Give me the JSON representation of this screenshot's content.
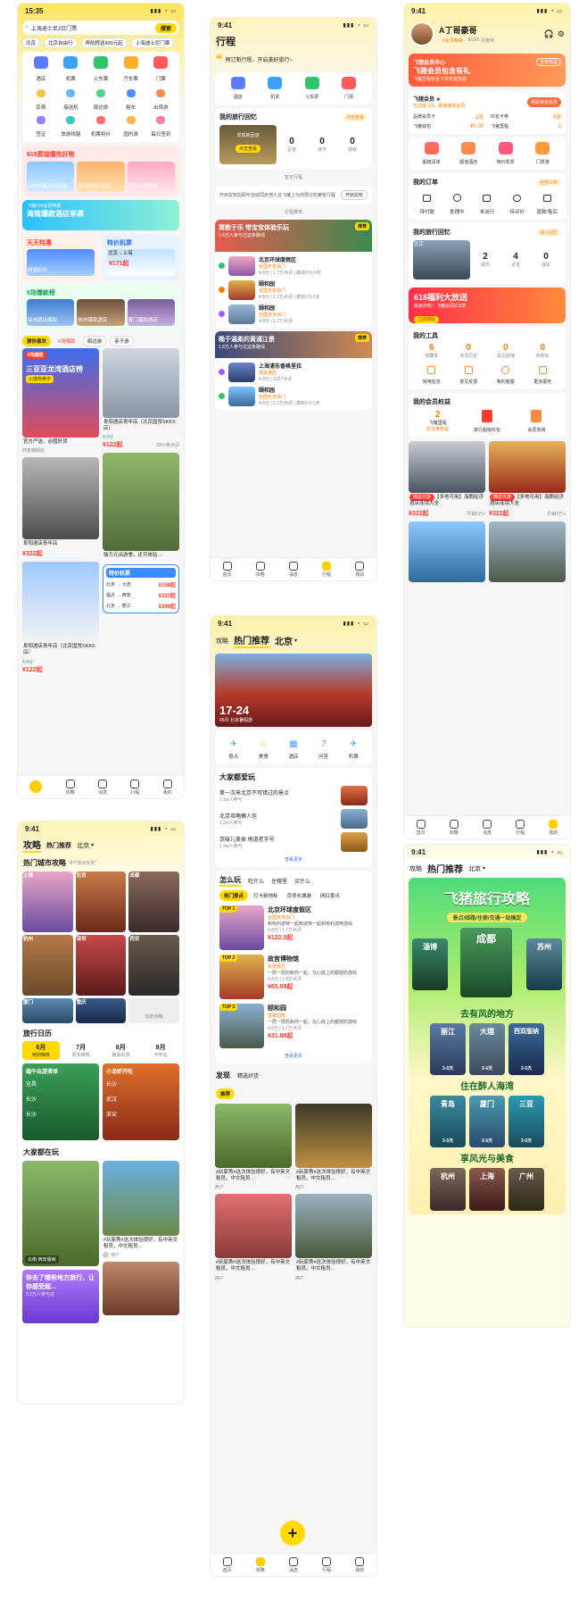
{
  "status_time_a": "15:35",
  "status_time": "9:41",
  "a": {
    "search_placeholder": "上海迪士尼2日门票",
    "search_btn": "搜索",
    "quick": [
      "北京",
      "北京自由行",
      "再航程送499元起",
      "上海迪士尼门票"
    ],
    "main_icons": [
      "酒店",
      "机票",
      "火车票",
      "汽车票",
      "门票"
    ],
    "sub_icons": [
      "民宿",
      "接送机",
      "周边游",
      "租车",
      "出境游",
      "签证",
      "旅游线路",
      "机票特价",
      "国内游",
      "每日签到"
    ],
    "promo1_title": "618费瑞播抢好物",
    "promo1_items": [
      "大会员每日抢全部",
      "每日好价0元起",
      "迪士尼城堡游"
    ],
    "promo2_title": "海南爆款酒店来袭",
    "promo2_sub": "飞猪618会员特惠",
    "deal_title": "天天特惠",
    "deal_sub": "超值好价",
    "flight_title": "特价机票",
    "flight_city": "北京→上海",
    "flight_price": "¥171起",
    "hotel_title": "6场爆款榜",
    "hotel_items": [
      "亚洲酒店爆款",
      "杭州爆款酒店",
      "厦门爆款酒店"
    ],
    "chips": [
      "猜你喜欢",
      "6场爆款",
      "周边游",
      "亲子游"
    ],
    "feed1_badge": "6场爆款",
    "feed1_title": "三亚亚龙湾酒店榜",
    "feed1_tag": "火爆热卖中",
    "feed1_cap": "官方严选，必囤好货",
    "feed1_shop": "商家旗舰店",
    "feed2_cap": "阜阳酒店青年店（北京国贸SKKS店）",
    "feed2_score": "4.9分",
    "feed2_price": "¥122起",
    "feed2_sold": "100+条点评",
    "feed3_cap": "阜阳酒店青年店",
    "feed3_price": "¥322起",
    "feed4_cap": "独万元出游季，还可体验…",
    "feed5_cap": "阜阳酒店青年店（北京国贸SKKS店）",
    "feed5_score": "4.9分",
    "feed5_price": "¥122起",
    "flight_card_title": "特价机票",
    "flight_rows": [
      {
        "route": "北京 → 大连",
        "price": "¥158起"
      },
      {
        "route": "临沂 → 西安",
        "price": "¥323起"
      },
      {
        "route": "北京 → 丽江",
        "price": "¥399起"
      }
    ],
    "tabs": [
      "",
      "攻略",
      "消息",
      "行程",
      "我的"
    ]
  },
  "b": {
    "title": "行程",
    "greeting": "预订新行程，开启美好旅行~",
    "icons": [
      "酒店",
      "机票",
      "火车票",
      "门票"
    ],
    "memory_title": "我的旅行回忆",
    "memory_link": "点击查看",
    "memory_card": "发现新足迹",
    "memory_btn": "点击查看",
    "stats": [
      {
        "v": "0",
        "l": "足迹"
      },
      {
        "v": "0",
        "l": "城市"
      },
      {
        "v": "0",
        "l": "成就"
      }
    ],
    "empty": "暂无行程",
    "auth_text": "开启授权后即可自动同步他人在飞猪上为你预订的某些行程",
    "auth_btn": "开启授权",
    "rec": "行程推荐",
    "rec1_title": "寓教于乐 带宝宝体验乐玩",
    "rec1_sub": "1.6万人参与过这条路线",
    "rec_badge": "推荐",
    "rec_items": [
      {
        "t": "北京环球度假区",
        "tag": "全国天天出门",
        "s": "4.8分 | 1.7万点评 | 路线约3小时"
      },
      {
        "t": "颐和园",
        "tag": "全国天天出门",
        "s": "4.8分 | 1.7万点评 | 游玩0.5-1天"
      },
      {
        "t": "颐和园",
        "tag": "全国天天出门",
        "s": "4.8分 | 1.7万点评"
      }
    ],
    "rec2_title": "晚于温柔的黄浦江景",
    "rec2_sub": "1.8万人参与过这条路线",
    "rec2_items": [
      {
        "t": "上海浦东香格里拉",
        "tag": "高级酒店",
        "s": "4.8分 | 1327点评"
      },
      {
        "t": "颐和园",
        "tag": "全国天天出门",
        "s": "4.8分 | 1.7万点评 | 游玩0.5-1天"
      }
    ],
    "tabs": [
      "首页",
      "攻略",
      "消息",
      "行程",
      "我的"
    ]
  },
  "c": {
    "name": "A丁哥豪哥",
    "tags": [
      "#会员等级",
      "8/165",
      "月度奖"
    ],
    "vip_title": "飞猪会员中心",
    "vip_text": "飞猪会员包含有礼",
    "vip_sub": "飞猪里程包含下单享受权益",
    "vip_btn": "全部权益",
    "level": "飞猪会员 ★",
    "level_sub": "已达成 1/2，距离高级会员",
    "level_btn": "领取黄金会员",
    "perks": [
      {
        "l": "品牌会员卡",
        "v": "1张"
      },
      {
        "l": "红包卡券",
        "v": "0张"
      },
      {
        "l": "飞猪钱包",
        "v": "¥0.00"
      },
      {
        "l": "飞猪里程",
        "v": "2"
      }
    ],
    "icons": [
      "超值清单",
      "超值酒店",
      "特价机票",
      "门票游"
    ],
    "orders_title": "我的订单",
    "orders_link": "全部订单",
    "orders": [
      "待付款",
      "处理中",
      "未出行",
      "待评价",
      "退款/售后"
    ],
    "memory_title": "我的旅行回忆",
    "memory_link": "进入回忆",
    "memory_city": "北京",
    "memory_stats": [
      {
        "v": "2",
        "l": "城市"
      },
      {
        "v": "4",
        "l": "足迹"
      },
      {
        "v": "0",
        "l": "成就"
      }
    ],
    "sale_title": "618福利大放送",
    "sale_sub": "就差你啦！飞猪会员618享",
    "sale_btn": "立即领取",
    "tools_title": "我的工具",
    "tools_stats": [
      {
        "v": "6",
        "l": "收藏夹"
      },
      {
        "v": "0",
        "l": "浏览历史"
      },
      {
        "v": "0",
        "l": "关注店铺"
      },
      {
        "v": "0",
        "l": "购物车"
      }
    ],
    "tools": [
      "常用信息",
      "意见反馈",
      "我的客服",
      "更多服务"
    ],
    "rights_title": "我的会员权益",
    "rights": [
      {
        "v": "2",
        "l": "飞猪里程"
      },
      {
        "v": "",
        "l": "旅行超级红包"
      },
      {
        "v": "",
        "l": "会员商城"
      }
    ],
    "rights_sub": "去兑换权益",
    "goods": [
      {
        "tag": "精选日游",
        "t": "【多地可用】海朗经济酒店连锁大全",
        "p": "¥322起",
        "s": "月销5万+"
      },
      {
        "tag": "精选日游",
        "t": "【多地可用】海朗经济酒店连锁大全",
        "p": "¥322起",
        "s": "月销5万+"
      }
    ],
    "tabs": [
      "首页",
      "攻略",
      "消息",
      "行程",
      "我的"
    ]
  },
  "d": {
    "tabs_top": [
      "攻略",
      "热门推荐",
      "北京"
    ],
    "hot_title": "热门城市攻略",
    "hot_sub": "“8个热点任务”",
    "cities": [
      "上海",
      "北京",
      "成都",
      "杭州",
      "深圳",
      "西安",
      "厦门",
      "重庆",
      "西安"
    ],
    "more": "玩的攻略",
    "cal_title": "旅行日历",
    "cal": [
      {
        "m": "6月",
        "s": "特别推荐"
      },
      {
        "m": "7月",
        "s": "更多推荐"
      },
      {
        "m": "8月",
        "s": "暑假出游"
      },
      {
        "m": "9月",
        "s": "开学后"
      }
    ],
    "list1_title": "端午出游清单",
    "list1": [
      "宜昌",
      "长沙",
      "长沙"
    ],
    "list2_title": "小龙虾开吃",
    "list2": [
      "长沙",
      "武汉",
      "淮安"
    ],
    "play_title": "大家都在玩",
    "play1_tag": "云南·西双版纳",
    "play2_cap": "#玩家秀#这次体验很好，有中英文租员，中文租员…",
    "play2_user": "用户",
    "play3_cap": "你去了哪些地方旅行，让你感受超…",
    "play3_sub": "2.2万人参与过"
  },
  "e": {
    "tabs_top": [
      "攻略",
      "热门推荐",
      "北京"
    ],
    "hero_date": "17-24",
    "hero_sub": "06月 北京暑假游",
    "icons": [
      "景点",
      "美食",
      "酒店",
      "问答",
      "机票"
    ],
    "love_title": "大家都爱玩",
    "love": [
      {
        "t": "第一次来北京不可错过的景点",
        "s": "2.1w人参与"
      },
      {
        "t": "北京攻略懒人包",
        "s": "1.2w人参与"
      },
      {
        "t": "京味儿美食 地道老字号",
        "s": "1.4w人参与"
      }
    ],
    "love_more": "查看更多",
    "how_tabs": [
      "怎么玩",
      "吃什么",
      "住哪里",
      "买什么"
    ],
    "how_chips": [
      "热门景点",
      "打卡新地标",
      "京郊长城游",
      "网红景点"
    ],
    "spots": [
      {
        "rank": "TOP 1",
        "t": "北京环球度假区",
        "tag": "全国天天出门",
        "d": "和哈利波特一起和波特一起和哈利波特游戏",
        "s": "4.8分 | 1.7万点评",
        "p": "¥122.0起"
      },
      {
        "rank": "TOP 2",
        "t": "故宫博物馆",
        "tag": "免费景区",
        "d": "一层一层的和你一起，在心底上的都部的游戏",
        "s": "4.8分 | 1.9万点评",
        "p": "¥65.89起"
      },
      {
        "rank": "TOP 3",
        "t": "颐和园",
        "tag": "皇家园林",
        "d": "一层一层的和你一起，在心底上的都部的游戏",
        "s": "4.8分 | 1.7万点评",
        "p": "¥31.88起"
      }
    ],
    "spots_more": "查看更多",
    "disc_tabs": [
      "发现",
      "精选好货"
    ],
    "disc_chip": "推荐",
    "posts": [
      {
        "t": "#玩家秀#这次体验很好，有中英文租员，中文租员…",
        "u": "用户"
      },
      {
        "t": "#玩家秀#这次体验很好，有中英文租员，中文租员…",
        "u": "用户"
      },
      {
        "t": "#玩家秀#这次体验很好，有中英文租员，中文租员…",
        "u": "用户"
      },
      {
        "t": "#玩家秀#这次体验很好，有中英文租员，中文租员…",
        "u": "用户"
      }
    ],
    "fab": "+",
    "tabs": [
      "首页",
      "攻略",
      "消息",
      "行程",
      "我的"
    ]
  },
  "f": {
    "tabs_top": [
      "攻略",
      "热门推荐",
      "北京"
    ],
    "poster_title": "飞猪旅行攻略",
    "poster_sub": "景点/线路/住宿/交通一站搞定",
    "hero_cities": [
      "淄博",
      "成都",
      "苏州"
    ],
    "sec1": "去有风的地方",
    "row1": [
      "丽江",
      "大理",
      "西双版纳"
    ],
    "sec2": "住在醉人海湾",
    "row2": [
      "青岛",
      "厦门",
      "三亚"
    ],
    "sec3": "享风光与美食",
    "row3": [
      "杭州",
      "上海",
      "广州"
    ],
    "days": "3-5天"
  }
}
